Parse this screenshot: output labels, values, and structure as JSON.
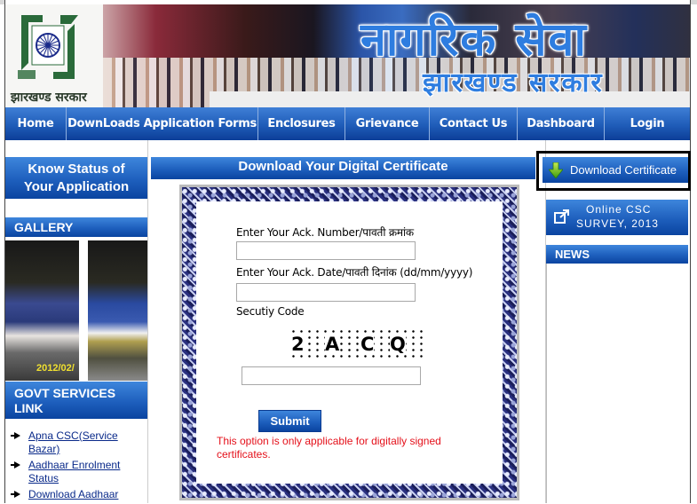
{
  "header": {
    "state_name_hindi": "झारखण्ड सरकार",
    "banner_title_hindi": "नागरिक सेवा",
    "banner_subtitle_hindi": "झारखण्ड सरकार",
    "logo_icon": "jharkhand-emblem-icon"
  },
  "nav": {
    "items": [
      {
        "label": "Home"
      },
      {
        "label": "DownLoads Application Forms"
      },
      {
        "label": "Enclosures"
      },
      {
        "label": "Grievance"
      },
      {
        "label": "Contact Us"
      },
      {
        "label": "Dashboard"
      },
      {
        "label": "Login"
      }
    ]
  },
  "left": {
    "status_button": {
      "line1": "Know Status of",
      "line2": "Your Application"
    },
    "gallery_title": "GALLERY",
    "gallery_stamp": "2012/02/",
    "govt_services_title": "GOVT SERVICES LINK",
    "links": [
      {
        "label": "Apna CSC(Service Bazar)"
      },
      {
        "label": "Aadhaar Enrolment Status"
      },
      {
        "label": "Download Aadhaar"
      }
    ]
  },
  "main": {
    "title": "Download Your Digital Certificate",
    "ack_number_label": "Enter Your Ack. Number/पावती क्रमांक",
    "ack_number_value": "",
    "ack_date_label": "Enter Your Ack. Date/पावती दिनांक (dd/mm/yyyy)",
    "ack_date_value": "",
    "security_label": "Secutiy Code",
    "captcha_chars": [
      "2",
      "A",
      "C",
      "Q"
    ],
    "security_value": "",
    "submit_label": "Submit",
    "note": "This option is only applicable for digitally signed certificates."
  },
  "right": {
    "download_button": {
      "label": "Download Certificate",
      "icon": "download-arrow-icon"
    },
    "survey_button": {
      "line1": "Online CSC",
      "line2": "SURVEY, 2013",
      "icon": "external-link-icon"
    },
    "news_title": "NEWS"
  },
  "colors": {
    "nav_blue": "#1f5cb8",
    "note_red": "#e4101a",
    "link_blue": "#0a2a8a"
  }
}
